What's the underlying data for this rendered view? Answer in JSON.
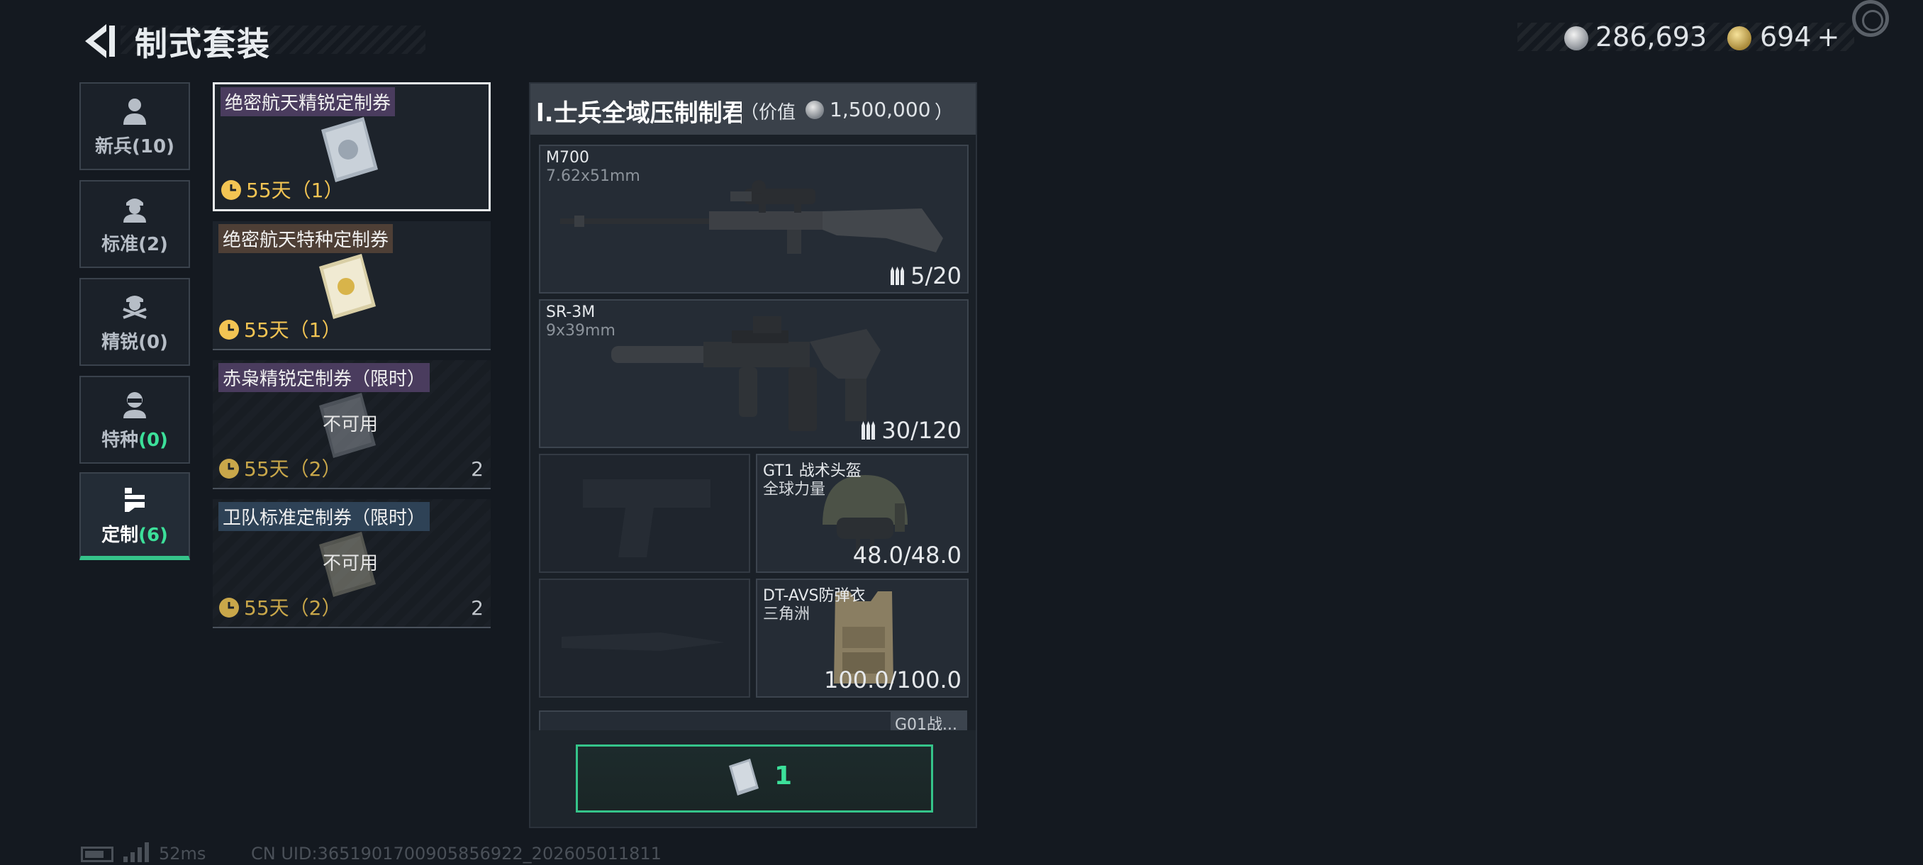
{
  "header": {
    "title": "制式套装",
    "currency": {
      "silver": "286,693",
      "gold": "694",
      "gold_plus": "+"
    }
  },
  "categories": [
    {
      "label": "新兵",
      "count": "(10)",
      "icon": "recruit-icon"
    },
    {
      "label": "标准",
      "count": "(2)",
      "icon": "standard-icon"
    },
    {
      "label": "精锐",
      "count": "(0)",
      "icon": "elite-icon"
    },
    {
      "label": "特种",
      "count": "(0)",
      "icon": "special-icon"
    },
    {
      "label": "定制",
      "count": "(6)",
      "icon": "custom-icon"
    }
  ],
  "vouchers": [
    {
      "name": "绝密航天精锐定制券",
      "time": "55天（1）",
      "status": "",
      "count": ""
    },
    {
      "name": "绝密航天特种定制券",
      "time": "55天（1）",
      "status": "",
      "count": ""
    },
    {
      "name": "赤枭精锐定制券（限时）",
      "time": "55天（2）",
      "status": "不可用",
      "count": "2"
    },
    {
      "name": "卫队标准定制券（限时）",
      "time": "55天（2）",
      "status": "不可用",
      "count": "2"
    }
  ],
  "loadout": {
    "name": "l.士兵全域压制制君",
    "value_open": "（价值",
    "value": "1,500,000",
    "value_close": "）",
    "primary": {
      "name": "M700",
      "caliber": "7.62x51mm",
      "ammo": "5/20"
    },
    "secondary": {
      "name": "SR-3M",
      "caliber": "9x39mm",
      "ammo": "30/120"
    },
    "helmet": {
      "name": "GT1 战术头盔",
      "origin": "全球力量",
      "durability": "48.0/48.0"
    },
    "armor": {
      "name": "DT-AVS防弹衣",
      "origin": "三角洲",
      "durability": "100.0/100.0"
    },
    "next_slot": "G01战..."
  },
  "redeem": {
    "count": "1"
  },
  "footer": {
    "ping": "52ms",
    "uid": "CN UID:3651901700905856922_202605011811"
  },
  "colors": {
    "accent_green": "#3ce09a",
    "timer_gold": "#f2c453",
    "background": "#141920"
  }
}
